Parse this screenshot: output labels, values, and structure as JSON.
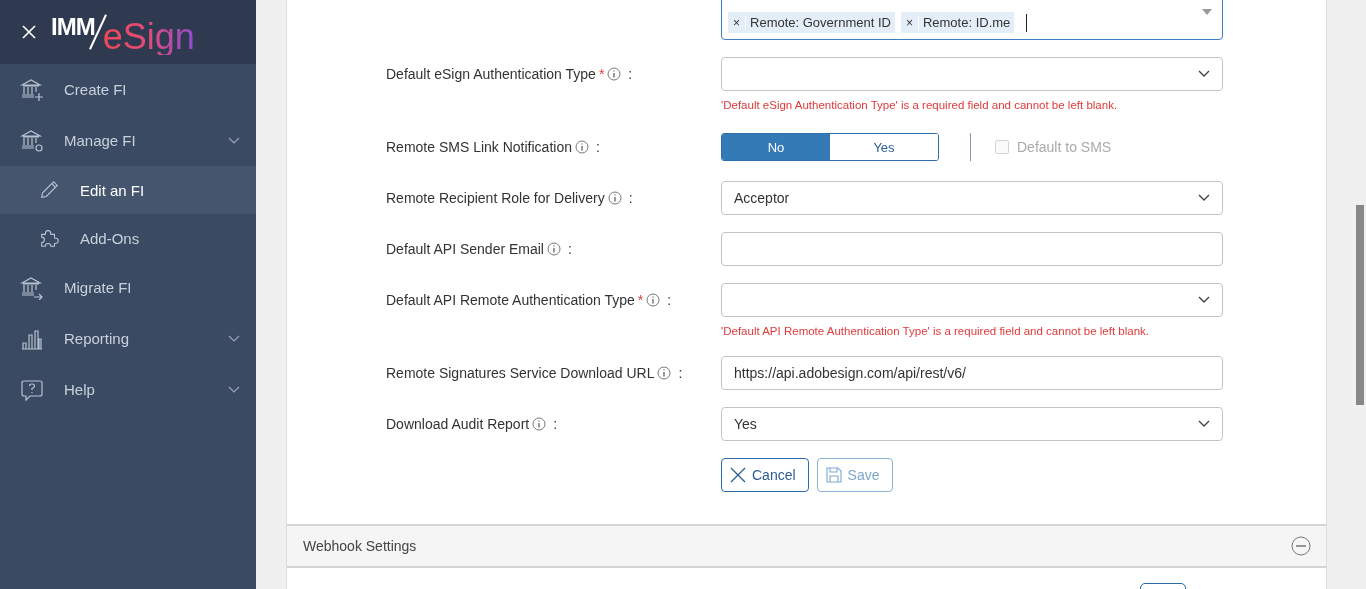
{
  "header": {
    "logo": {
      "prefix": "IMM",
      "suffix": "eSign"
    }
  },
  "sidebar": {
    "items": [
      {
        "label": "Create FI",
        "expandable": false,
        "selected": false
      },
      {
        "label": "Manage FI",
        "expandable": true,
        "selected": false,
        "children": [
          {
            "label": "Edit an FI",
            "selected": true
          },
          {
            "label": "Add-Ons",
            "selected": false
          }
        ]
      },
      {
        "label": "Migrate FI",
        "expandable": false,
        "selected": false
      },
      {
        "label": "Reporting",
        "expandable": true,
        "selected": false
      },
      {
        "label": "Help",
        "expandable": true,
        "selected": false
      }
    ]
  },
  "form": {
    "fields": [
      {
        "kind": "tags",
        "tags": [
          {
            "remove": "×",
            "label": "Remote: Government ID"
          },
          {
            "remove": "×",
            "label": "Remote: ID.me"
          }
        ],
        "focused": true
      },
      {
        "kind": "select",
        "label": "Default eSign Authentication Type",
        "marker": "*",
        "suffix": ":",
        "error": "'Default eSign Authentication Type' is a required field and cannot be left blank."
      },
      {
        "kind": "toggle",
        "label": "Remote SMS Link Notification",
        "suffix": ":",
        "options": [
          {
            "label": "No",
            "selected": true
          },
          {
            "label": "Yes",
            "selected": false
          }
        ],
        "checkbox": {
          "label": "Default to SMS",
          "checked": false,
          "disabled": true
        }
      },
      {
        "kind": "select",
        "label": "Remote Recipient Role for Delivery",
        "suffix": ":",
        "value": "Acceptor"
      },
      {
        "kind": "input",
        "label": "Default API Sender Email",
        "suffix": ":"
      },
      {
        "kind": "select",
        "label": "Default API Remote Authentication Type",
        "marker": "*",
        "suffix": ":",
        "error": "'Default API Remote Authentication Type' is a required field and cannot be left blank."
      },
      {
        "kind": "input",
        "label": "Remote Signatures Service Download URL",
        "suffix": ":",
        "value": "https://api.adobesign.com/api/rest/v6/"
      },
      {
        "kind": "select",
        "label": "Download Audit Report",
        "suffix": ":",
        "value": "Yes"
      }
    ],
    "buttons": [
      {
        "kind": "cancel",
        "label": "Cancel",
        "disabled": false
      },
      {
        "kind": "save",
        "label": "Save",
        "disabled": true
      }
    ]
  },
  "section": {
    "title": "Webhook Settings",
    "expanded": true
  }
}
